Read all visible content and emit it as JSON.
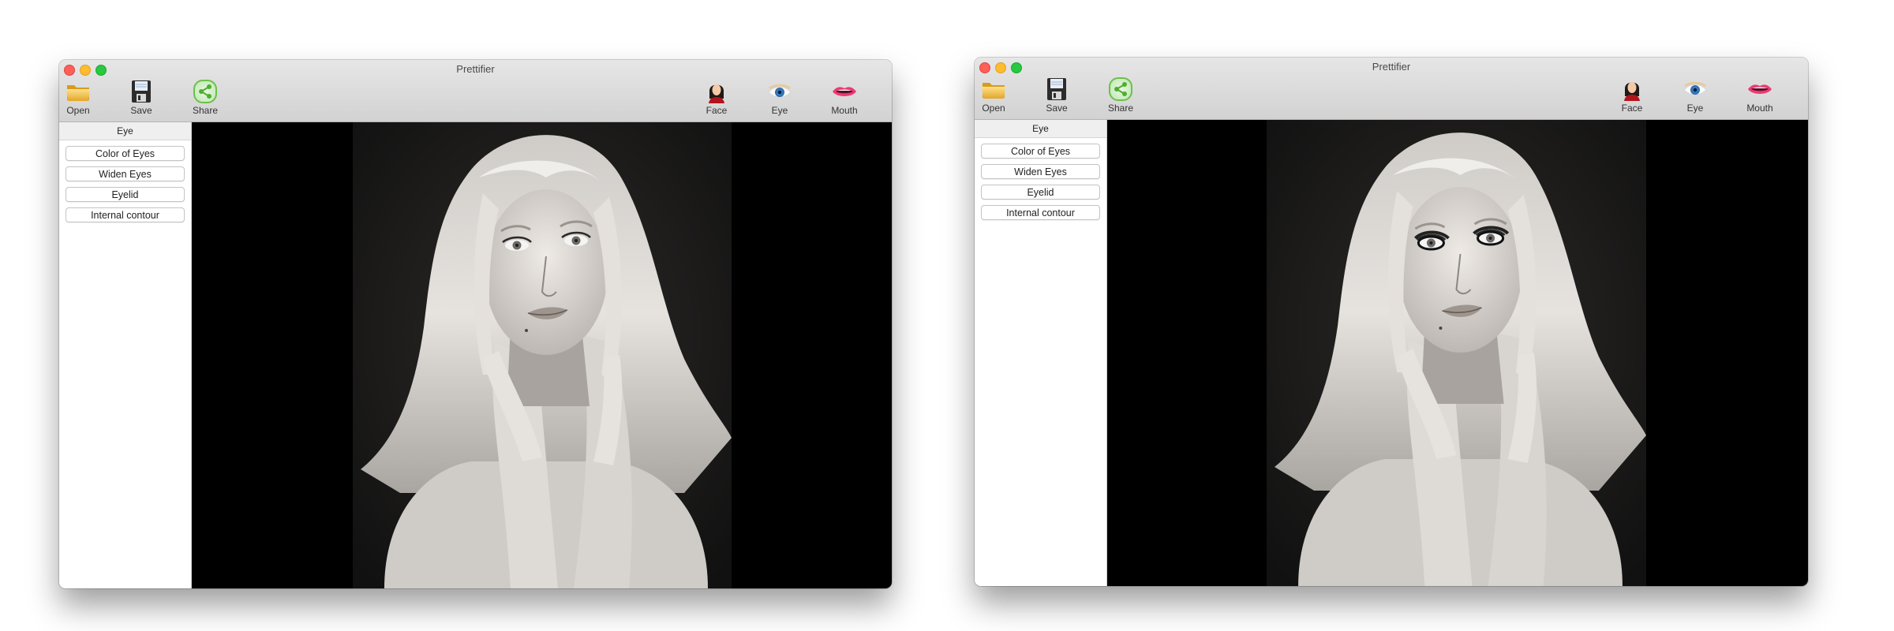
{
  "windows": [
    {
      "id": "original",
      "title": "Prettifier",
      "toolbar": {
        "left": [
          {
            "label": "Open",
            "icon": "folder-icon"
          },
          {
            "label": "Save",
            "icon": "floppy-disk-icon"
          },
          {
            "label": "Share",
            "icon": "share-icon"
          }
        ],
        "right": [
          {
            "label": "Face",
            "icon": "face-icon"
          },
          {
            "label": "Eye",
            "icon": "eye-icon"
          },
          {
            "label": "Mouth",
            "icon": "mouth-icon"
          }
        ]
      },
      "sidebar": {
        "header": "Eye",
        "buttons": [
          "Color of Eyes",
          "Widen Eyes",
          "Eyelid",
          "Internal contour"
        ]
      },
      "canvas": {
        "image": "black-and-white portrait of a blonde woman",
        "eye_contour_applied": false
      }
    },
    {
      "id": "edited",
      "title": "Prettifier",
      "toolbar": {
        "left": [
          {
            "label": "Open",
            "icon": "folder-icon"
          },
          {
            "label": "Save",
            "icon": "floppy-disk-icon"
          },
          {
            "label": "Share",
            "icon": "share-icon"
          }
        ],
        "right": [
          {
            "label": "Face",
            "icon": "face-icon"
          },
          {
            "label": "Eye",
            "icon": "eye-icon"
          },
          {
            "label": "Mouth",
            "icon": "mouth-icon"
          }
        ]
      },
      "sidebar": {
        "header": "Eye",
        "buttons": [
          "Color of Eyes",
          "Widen Eyes",
          "Eyelid",
          "Internal contour"
        ]
      },
      "canvas": {
        "image": "black-and-white portrait of a blonde woman",
        "eye_contour_applied": true
      }
    }
  ],
  "colors": {
    "close": "#fe5f57",
    "minimize": "#febc2e",
    "maximize": "#28c840",
    "canvas_bg": "#000000"
  }
}
